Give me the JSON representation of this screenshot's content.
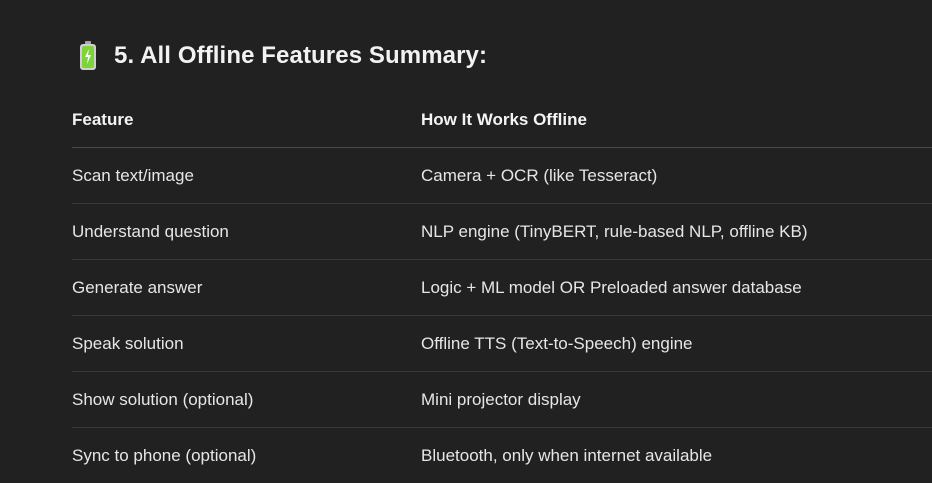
{
  "section": {
    "icon": "battery-icon",
    "title": "5. All Offline Features Summary:"
  },
  "table": {
    "headers": [
      "Feature",
      "How It Works Offline"
    ],
    "rows": [
      [
        "Scan text/image",
        "Camera + OCR (like Tesseract)"
      ],
      [
        "Understand question",
        "NLP engine (TinyBERT, rule-based NLP, offline KB)"
      ],
      [
        "Generate answer",
        "Logic + ML model OR Preloaded answer database"
      ],
      [
        "Speak solution",
        "Offline TTS (Text-to-Speech) engine"
      ],
      [
        "Show solution (optional)",
        "Mini projector display"
      ],
      [
        "Sync to phone (optional)",
        "Bluetooth, only when internet available"
      ]
    ]
  },
  "colors": {
    "background": "#212121",
    "text": "#ececec",
    "battery_green": "#7fd33a"
  }
}
